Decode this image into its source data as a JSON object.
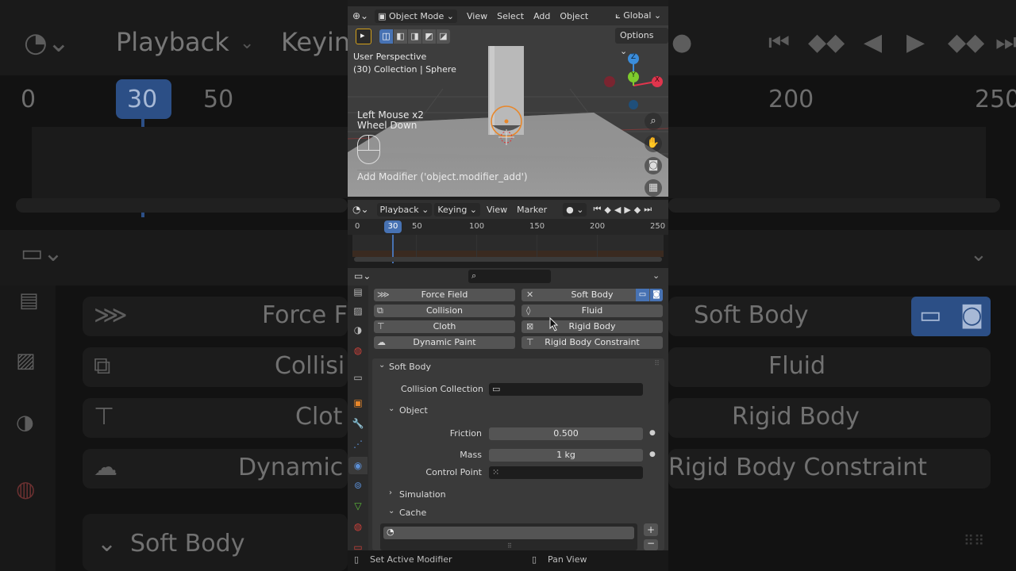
{
  "viewport": {
    "header": {
      "mode": "Object Mode",
      "menus": [
        "View",
        "Select",
        "Add",
        "Object"
      ],
      "orientation": "Global",
      "options": "Options"
    },
    "perspective": "User Perspective",
    "collection": "(30) Collection | Sphere",
    "input_line1": "Left Mouse x2",
    "input_line2": "Wheel Down",
    "operator": "Add Modifier ('object.modifier_add')",
    "gizmo_x": "X",
    "gizmo_y": "Y",
    "gizmo_z": "Z"
  },
  "timeline": {
    "menus": [
      "Playback",
      "Keying",
      "View",
      "Marker"
    ],
    "current_frame": "30",
    "ticks": [
      "0",
      "50",
      "100",
      "150",
      "200",
      "250"
    ]
  },
  "physics": {
    "buttons": [
      {
        "label": "Force Field",
        "icon": "force-field-icon"
      },
      {
        "label": "Soft Body",
        "icon": "close-icon"
      },
      {
        "label": "Collision",
        "icon": "collision-icon"
      },
      {
        "label": "Fluid",
        "icon": "fluid-icon"
      },
      {
        "label": "Cloth",
        "icon": "cloth-icon"
      },
      {
        "label": "Rigid Body",
        "icon": "rigid-body-icon"
      },
      {
        "label": "Dynamic Paint",
        "icon": "dynamic-paint-icon"
      },
      {
        "label": "Rigid Body Constraint",
        "icon": "constraint-icon"
      }
    ],
    "panel_title": "Soft Body",
    "collision_collection_label": "Collision Collection",
    "object_section": "Object",
    "friction_label": "Friction",
    "friction_value": "0.500",
    "mass_label": "Mass",
    "mass_value": "1 kg",
    "control_point_label": "Control Point",
    "simulation_section": "Simulation",
    "cache_section": "Cache"
  },
  "statusbar": {
    "left": "Set Active Modifier",
    "right": "Pan View"
  },
  "background": {
    "playback": "Playback",
    "keying": "Keyin",
    "frames": [
      "0",
      "30",
      "50",
      "200",
      "250"
    ],
    "left_items": [
      "Force F",
      "Collisi",
      "Clot",
      "Dynamic"
    ],
    "right_items": [
      "Soft Body",
      "Fluid",
      "Rigid Body",
      "Rigid Body Constraint"
    ],
    "soft_body": "Soft Body"
  },
  "colors": {
    "accent_blue": "#4772b3",
    "orange_select": "#e8872a",
    "axis_x": "#e0354d",
    "axis_y": "#7ecb2d",
    "axis_z": "#3b8ddb"
  }
}
